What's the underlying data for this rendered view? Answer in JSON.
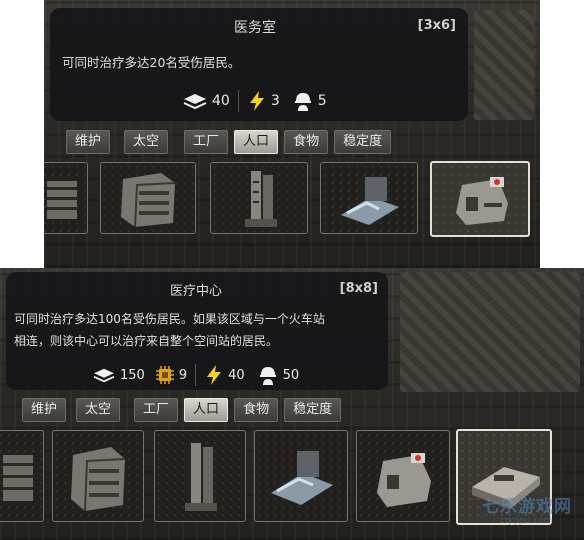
{
  "screens": [
    {
      "tooltip": {
        "title": "医务室",
        "size": "[3x6]",
        "description_lines": [
          "可同时治疗多达20名受伤居民。"
        ],
        "cost": {
          "materials": "40",
          "power": "3",
          "workers": "5"
        }
      },
      "tabs": [
        "维护",
        "太空",
        "工厂",
        "人口",
        "食物",
        "稳定度"
      ],
      "active_tab": "人口"
    },
    {
      "tooltip": {
        "title": "医疗中心",
        "size": "[8x8]",
        "description_lines": [
          "可同时治疗多达100名受伤居民。如果该区域与一个火车站",
          "相连，则该中心可以治疗来自整个空间站的居民。"
        ],
        "cost": {
          "materials": "150",
          "chips": "9",
          "power": "40",
          "workers": "50"
        }
      },
      "tabs": [
        "维护",
        "太空",
        "工厂",
        "人口",
        "食物",
        "稳定度"
      ],
      "active_tab": "人口"
    }
  ],
  "watermark": {
    "text": "七乐游戏网",
    "url": "cqqipu.com"
  },
  "icons": {
    "materials": "stack-icon",
    "chips": "chip-icon",
    "power": "lightning-icon",
    "workers": "worker-helmet-icon"
  },
  "colors": {
    "power": "#f4d21f",
    "chip": "#e0a11a",
    "tab_active": "#d8d6cf",
    "tooltip_bg": "#161618"
  }
}
